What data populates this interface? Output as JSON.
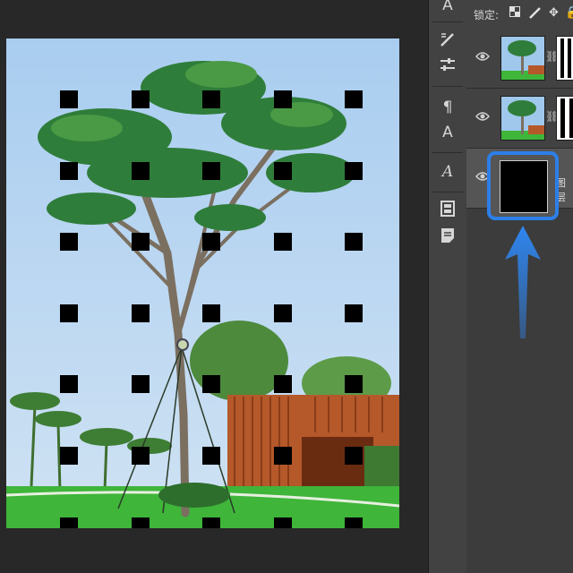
{
  "layers_panel": {
    "lock_label": "锁定:",
    "lock_icons": [
      "lock-transparent-icon",
      "lock-paint-icon",
      "lock-move-icon",
      "lock-all-icon"
    ],
    "layers": [
      {
        "thumbnail": "tree-photo",
        "has_mask": true,
        "mask_style": "vertical-stripes"
      },
      {
        "thumbnail": "tree-photo",
        "has_mask": true,
        "mask_style": "vertical-stripes"
      },
      {
        "thumbnail": "black-fill",
        "selected": true,
        "name_fragment": "图层"
      }
    ]
  },
  "tool_strip": {
    "icons": [
      "character-icon",
      "brush-settings-icon",
      "adjustments-icon",
      "paragraph-style-icon",
      "character-style-icon",
      "glyphs-icon",
      "properties-icon",
      "notes-icon"
    ]
  },
  "canvas": {
    "dot_grid": {
      "rows": 7,
      "cols": 5
    }
  },
  "colors": {
    "highlight": "#2c7fe8",
    "panel_bg": "#424242",
    "workspace_bg": "#282828"
  }
}
